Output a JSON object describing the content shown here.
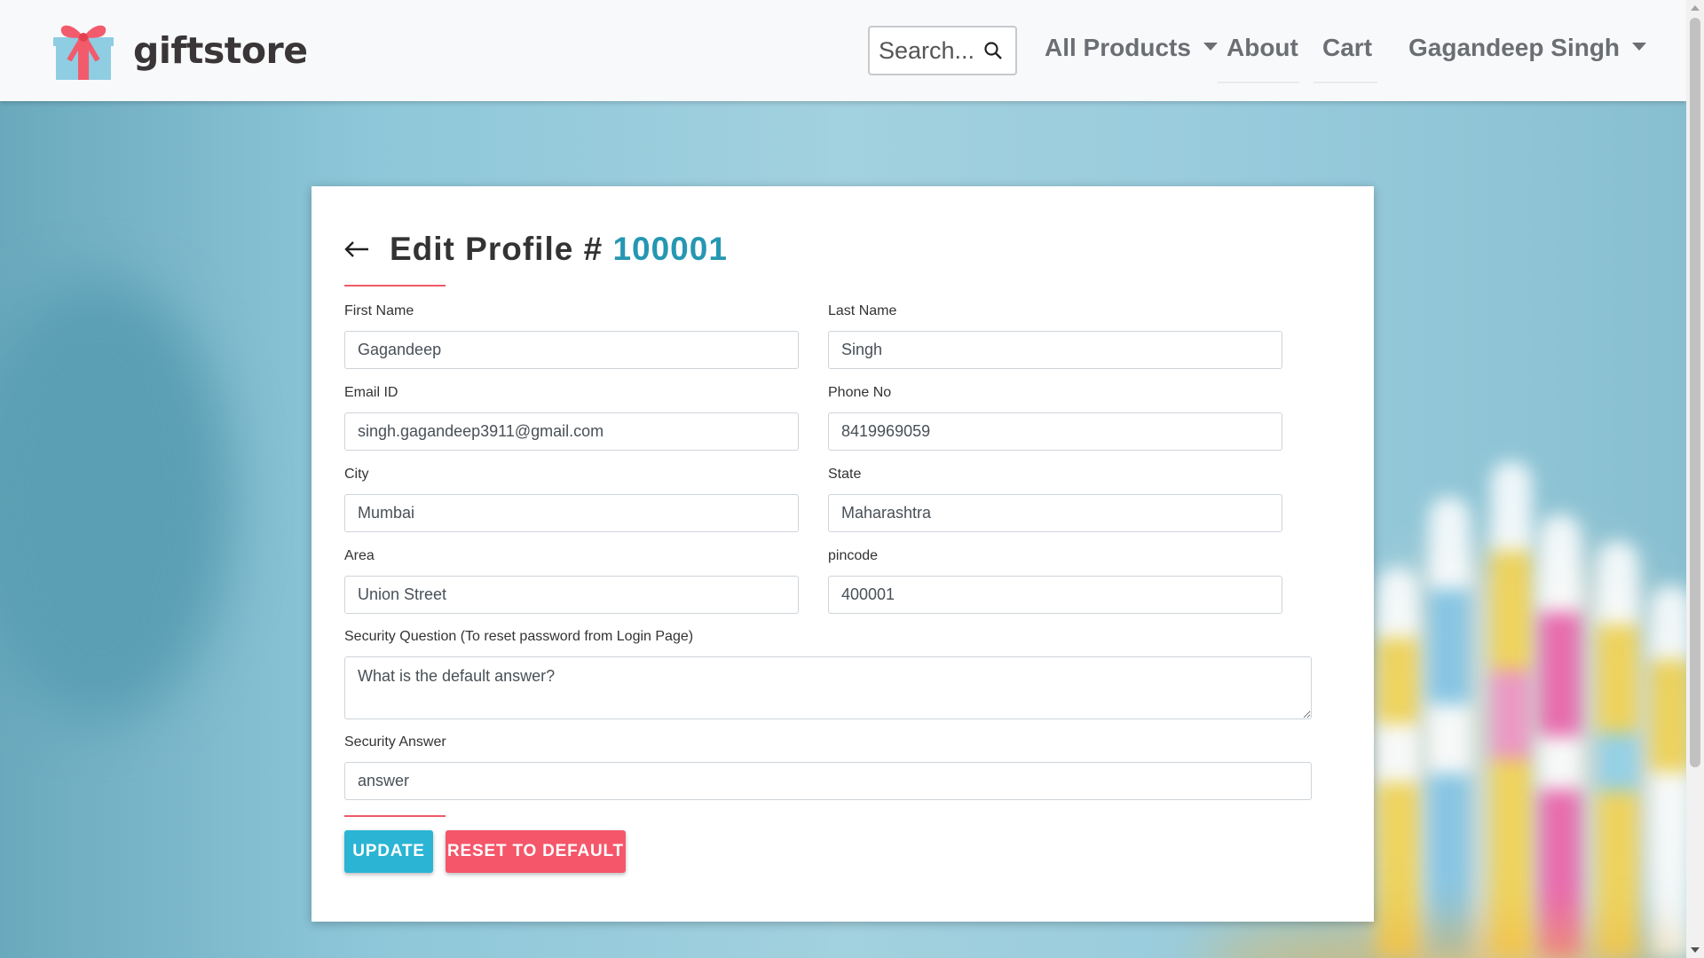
{
  "navbar": {
    "brand": "giftstore",
    "search_placeholder": "Search...",
    "links": {
      "products": "All Products",
      "about": "About",
      "cart": "Cart",
      "user": "Gagandeep Singh"
    }
  },
  "form": {
    "title": "Edit Profile #",
    "profile_id": "100001",
    "fields": {
      "first_name": {
        "label": "First Name",
        "value": "Gagandeep"
      },
      "last_name": {
        "label": "Last Name",
        "value": "Singh"
      },
      "email": {
        "label": "Email ID",
        "value": "singh.gagandeep3911@gmail.com"
      },
      "phone": {
        "label": "Phone No",
        "value": "8419969059"
      },
      "city": {
        "label": "City",
        "value": "Mumbai"
      },
      "state": {
        "label": "State",
        "value": "Maharashtra"
      },
      "area": {
        "label": "Area",
        "value": "Union Street"
      },
      "pincode": {
        "label": "pincode",
        "value": "400001"
      },
      "security_question": {
        "label": "Security Question (To reset password from Login Page)",
        "value": "What is the default answer?"
      },
      "security_answer": {
        "label": "Security Answer",
        "value": "answer"
      }
    },
    "buttons": {
      "update": "UPDATE",
      "reset": "RESET TO DEFAULT"
    }
  },
  "colors": {
    "accent_teal": "#2597b2",
    "button_update": "#2bb4d4",
    "button_reset": "#f5566a",
    "divider_red": "#ef5a67"
  },
  "icons": [
    "gift-logo-icon",
    "search-icon",
    "chevron-down-icon",
    "back-arrow-icon",
    "resize-grip-icon"
  ]
}
